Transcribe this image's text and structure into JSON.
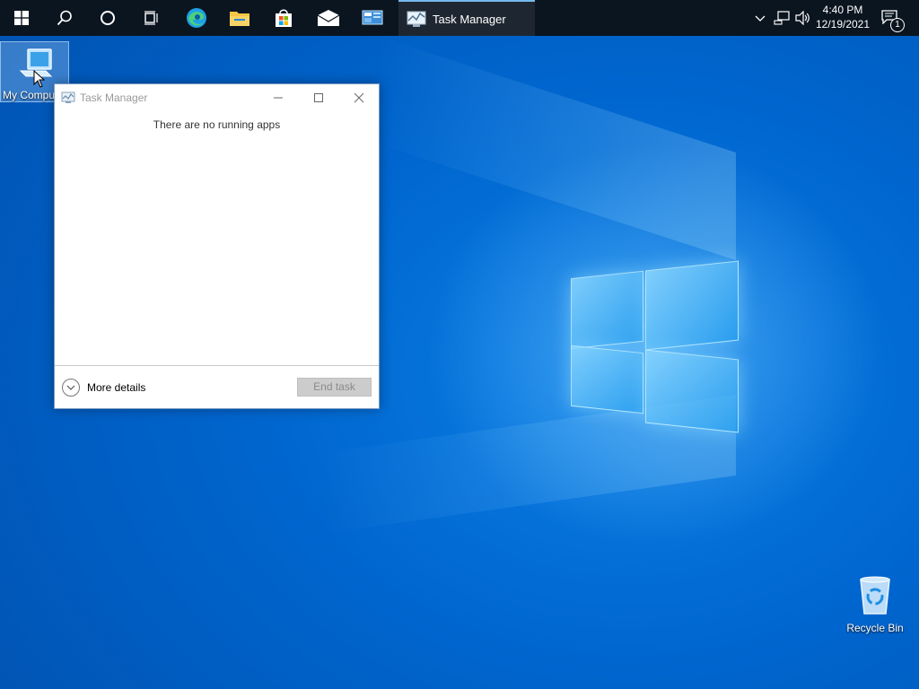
{
  "taskbar": {
    "active_app_label": "Task Manager",
    "clock": {
      "time": "4:40 PM",
      "date": "12/19/2021"
    },
    "notification_count": "1",
    "pinned": [
      "windows-start",
      "search",
      "cortana",
      "task-view",
      "edge",
      "file-explorer",
      "microsoft-store",
      "mail",
      "control-panel"
    ]
  },
  "desktop": {
    "icons": [
      {
        "label": "My Computer"
      },
      {
        "label": "Recycle Bin"
      }
    ]
  },
  "task_manager": {
    "title": "Task Manager",
    "message": "There are no running apps",
    "more_details_label": "More details",
    "end_task_label": "End task"
  },
  "colors": {
    "taskbar_bg": "#0b1520",
    "desktop_blue": "#0066cf",
    "accent": "#76b9ed",
    "disabled_button": "#cccccc"
  }
}
